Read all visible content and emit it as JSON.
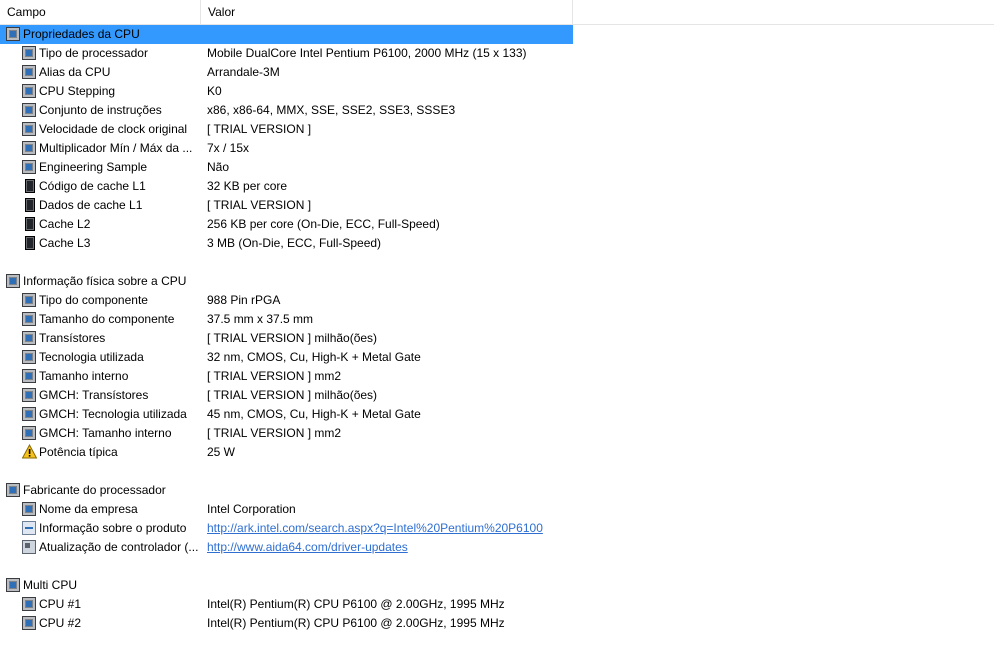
{
  "header": {
    "col_field": "Campo",
    "col_value": "Valor"
  },
  "groups": [
    {
      "title": "Propriedades da CPU",
      "items": [
        {
          "label": "Tipo de processador",
          "value": "Mobile DualCore Intel Pentium P6100, 2000 MHz (15 x 133)"
        },
        {
          "label": "Alias da CPU",
          "value": "Arrandale-3M"
        },
        {
          "label": "CPU Stepping",
          "value": "K0"
        },
        {
          "label": "Conjunto de instruções",
          "value": "x86, x86-64, MMX, SSE, SSE2, SSE3, SSSE3"
        },
        {
          "label": "Velocidade de clock original",
          "value": "[ TRIAL VERSION ]"
        },
        {
          "label": "Multiplicador Mín / Máx da ...",
          "value": "7x / 15x"
        },
        {
          "label": "Engineering Sample",
          "value": "Não"
        },
        {
          "label": "Código de cache L1",
          "value": "32 KB per core"
        },
        {
          "label": "Dados de cache L1",
          "value": "[ TRIAL VERSION ]"
        },
        {
          "label": "Cache L2",
          "value": "256 KB per core  (On-Die, ECC, Full-Speed)"
        },
        {
          "label": "Cache L3",
          "value": "3 MB  (On-Die, ECC, Full-Speed)"
        }
      ]
    },
    {
      "title": "Informação física sobre a CPU",
      "items": [
        {
          "label": "Tipo do componente",
          "value": "988 Pin rPGA"
        },
        {
          "label": "Tamanho do componente",
          "value": "37.5 mm x 37.5 mm"
        },
        {
          "label": "Transístores",
          "value": "[ TRIAL VERSION ] milhão(ões)"
        },
        {
          "label": "Tecnologia utilizada",
          "value": "32 nm, CMOS, Cu, High-K + Metal Gate"
        },
        {
          "label": "Tamanho interno",
          "value": "[ TRIAL VERSION ] mm2"
        },
        {
          "label": "GMCH: Transístores",
          "value": "[ TRIAL VERSION ] milhão(ões)"
        },
        {
          "label": "GMCH: Tecnologia utilizada",
          "value": "45 nm, CMOS, Cu, High-K + Metal Gate"
        },
        {
          "label": "GMCH: Tamanho interno",
          "value": "[ TRIAL VERSION ] mm2"
        },
        {
          "label": "Potência típica",
          "value": "25 W"
        }
      ]
    },
    {
      "title": "Fabricante do processador",
      "items": [
        {
          "label": "Nome da empresa",
          "value": "Intel Corporation"
        },
        {
          "label": "Informação sobre o produto",
          "value": "http://ark.intel.com/search.aspx?q=Intel%20Pentium%20P6100"
        },
        {
          "label": "Atualização de controlador (...",
          "value": "http://www.aida64.com/driver-updates"
        }
      ]
    },
    {
      "title": "Multi CPU",
      "items": [
        {
          "label": "CPU #1",
          "value": "Intel(R) Pentium(R) CPU P6100 @ 2.00GHz, 1995 MHz"
        },
        {
          "label": "CPU #2",
          "value": "Intel(R) Pentium(R) CPU P6100 @ 2.00GHz, 1995 MHz"
        }
      ]
    }
  ],
  "colors": {
    "selection": "#3399ff",
    "link": "#2f6fd1",
    "header_border": "#e5e5e5"
  },
  "icons": {
    "cpu": "cpu-chip-icon",
    "cache": "memory-chip-icon",
    "warning": "warning-triangle-icon",
    "link": "web-link-icon",
    "driver": "driver-update-icon"
  }
}
